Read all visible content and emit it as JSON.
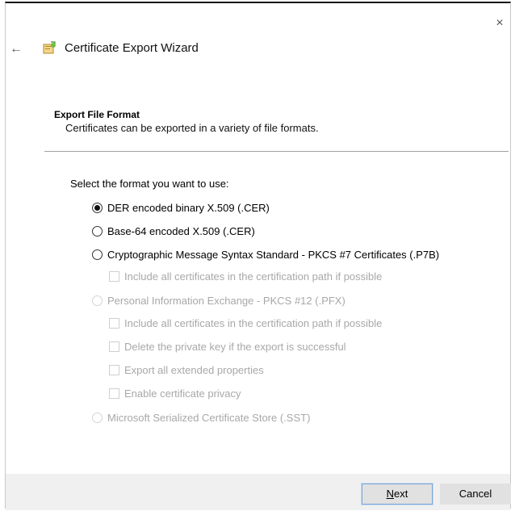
{
  "window": {
    "title": "Certificate Export Wizard",
    "close_glyph": "×",
    "back_glyph": "←"
  },
  "section": {
    "title": "Export File Format",
    "description": "Certificates can be exported in a variety of file formats."
  },
  "prompt": "Select the format you want to use:",
  "options": [
    {
      "label": "DER encoded binary X.509 (.CER)",
      "checked": true,
      "enabled": true
    },
    {
      "label": "Base-64 encoded X.509 (.CER)",
      "checked": false,
      "enabled": true
    },
    {
      "label": "Cryptographic Message Syntax Standard - PKCS #7 Certificates (.P7B)",
      "checked": false,
      "enabled": true
    },
    {
      "label": "Include all certificates in the certification path if possible",
      "type": "checkbox",
      "enabled": false
    },
    {
      "label": "Personal Information Exchange - PKCS #12 (.PFX)",
      "checked": false,
      "enabled": false
    },
    {
      "label": "Include all certificates in the certification path if possible",
      "type": "checkbox",
      "enabled": false
    },
    {
      "label": "Delete the private key if the export is successful",
      "type": "checkbox",
      "enabled": false
    },
    {
      "label": "Export all extended properties",
      "type": "checkbox",
      "enabled": false
    },
    {
      "label": "Enable certificate privacy",
      "type": "checkbox",
      "enabled": false
    },
    {
      "label": "Microsoft Serialized Certificate Store (.SST)",
      "checked": false,
      "enabled": false
    }
  ],
  "buttons": {
    "next": "Next",
    "cancel": "Cancel"
  },
  "icons": {
    "wizard": "certificate-wizard-icon",
    "back": "back-arrow-icon",
    "close": "close-icon"
  }
}
